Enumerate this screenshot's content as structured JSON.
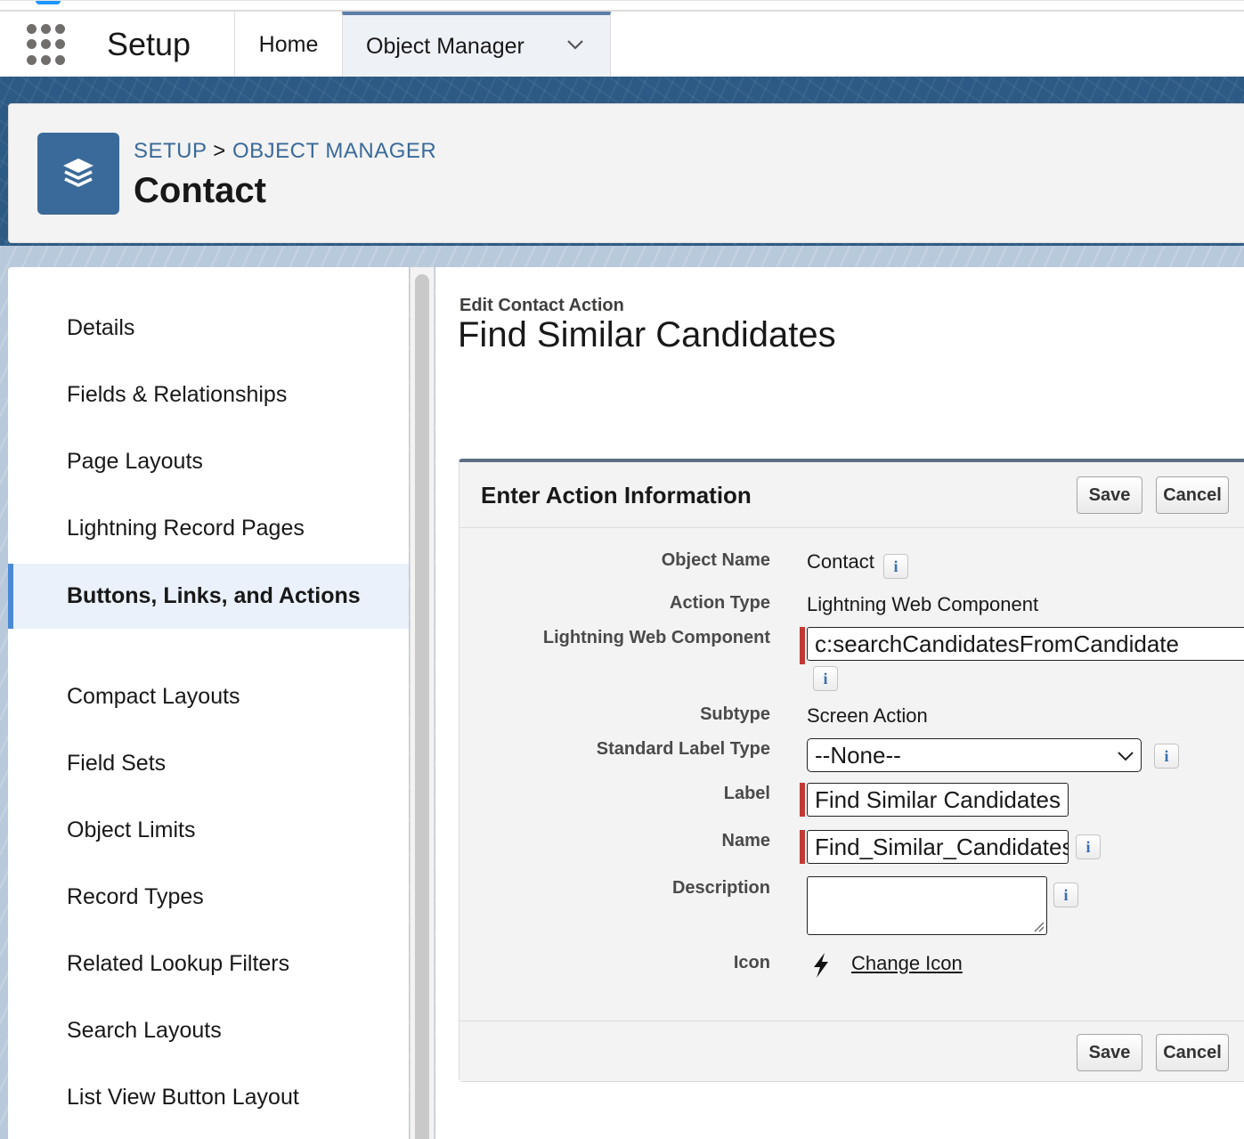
{
  "nav": {
    "app_name": "Setup",
    "tabs": [
      {
        "label": "Home"
      },
      {
        "label": "Object Manager"
      }
    ]
  },
  "header": {
    "breadcrumb_root": "SETUP",
    "breadcrumb_separator": ">",
    "breadcrumb_current": "OBJECT MANAGER",
    "title": "Contact"
  },
  "sidebar": {
    "items": [
      {
        "label": "Details"
      },
      {
        "label": "Fields & Relationships"
      },
      {
        "label": "Page Layouts"
      },
      {
        "label": "Lightning Record Pages"
      },
      {
        "label": "Buttons, Links, and Actions"
      },
      {
        "label": "Compact Layouts"
      },
      {
        "label": "Field Sets"
      },
      {
        "label": "Object Limits"
      },
      {
        "label": "Record Types"
      },
      {
        "label": "Related Lookup Filters"
      },
      {
        "label": "Search Layouts"
      },
      {
        "label": "List View Button Layout"
      }
    ]
  },
  "main": {
    "subtitle": "Edit Contact Action",
    "title": "Find Similar Candidates",
    "panel_title": "Enter Action Information",
    "save_label": "Save",
    "cancel_label": "Cancel",
    "info_glyph": "i",
    "fields": {
      "object_name_label": "Object Name",
      "object_name_value": "Contact",
      "action_type_label": "Action Type",
      "action_type_value": "Lightning Web Component",
      "lwc_label": "Lightning Web Component",
      "lwc_value": "c:searchCandidatesFromCandidate",
      "subtype_label": "Subtype",
      "subtype_value": "Screen Action",
      "std_label_type_label": "Standard Label Type",
      "std_label_type_value": "--None--",
      "label_label": "Label",
      "label_value": "Find Similar Candidates",
      "name_label": "Name",
      "name_value": "Find_Similar_Candidates",
      "description_label": "Description",
      "description_value": "",
      "icon_label": "Icon",
      "change_icon_link": "Change Icon"
    }
  },
  "colors": {
    "brand_blue": "#3a6a99",
    "band_blue": "#2c5a85",
    "required_red": "#c23934",
    "active_item_bg": "#eaf1fb"
  },
  "icons": {
    "app_launcher": "waffle-icon",
    "object_icon": "stacked-layers-icon",
    "dropdown": "chevron-down-icon",
    "info": "info-icon",
    "action_icon": "lightning-bolt-icon"
  }
}
